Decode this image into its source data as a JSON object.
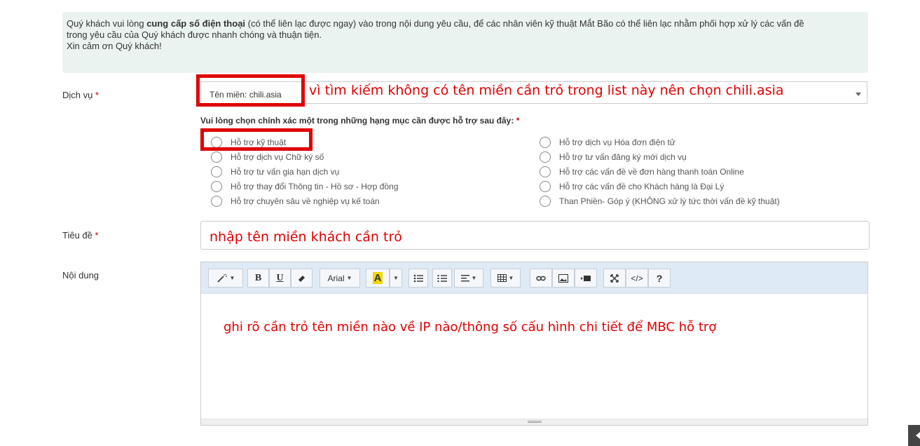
{
  "notice": {
    "line1_prefix": "Quý khách vui lòng ",
    "line1_bold": "cung cấp số điện thoại",
    "line1_suffix": " (có thể liên lạc được ngay) vào trong nội dung yêu cầu, để các nhân viên kỹ thuật Mắt Bão có thể liên lạc nhằm phối hợp xử lý các vấn đề",
    "line2": "trong yêu cầu của Quý khách được nhanh chóng và thuận tiện.",
    "line3": "Xin cảm ơn Quý khách!"
  },
  "service": {
    "label": "Dịch vụ",
    "required": "*",
    "selected_value": "Tên miền: chili.asia",
    "annotation": "vì tìm kiếm không có tên miền cần trỏ trong list này nên chọn chili.asia"
  },
  "categories": {
    "title": "Vui lòng chọn chính xác một trong những hạng mục cần được hỗ trợ sau đây:",
    "required": "*",
    "left": [
      "Hỗ trợ kỹ thuật",
      "Hỗ trợ dịch vụ Chữ ký số",
      "Hỗ trợ tư vấn gia hạn dịch vụ",
      "Hỗ trợ thay đổi Thông tin - Hồ sơ - Hợp đồng",
      "Hỗ trợ chuyên sâu về nghiệp vụ kế toán"
    ],
    "right": [
      "Hỗ trợ dịch vụ Hóa đơn điện tử",
      "Hỗ trợ tư vấn đăng ký mới dịch vụ",
      "Hỗ trợ các vấn đề về đơn hàng thanh toán Online",
      "Hỗ trợ các vấn đề cho Khách hàng là Đại Lý",
      "Than Phiền- Góp ý (KHÔNG xử lý tức thời vấn đề kỹ thuật)"
    ]
  },
  "subject": {
    "label": "Tiêu đề",
    "required": "*",
    "annotation": "nhập tên miền khách cần trỏ"
  },
  "content": {
    "label": "Nội dung",
    "annotation": "ghi rõ cần trỏ tên miền nào về IP nào/thông số cấu hình chi tiết để MBC hỗ trợ"
  },
  "toolbar": {
    "font_name": "Arial",
    "bold": "B",
    "underline": "U",
    "help": "?",
    "highlight_letter": "A",
    "highlight_color": "#f2d600"
  },
  "colors": {
    "annotation_red": "#e00000",
    "notice_bg": "#eaf3f0",
    "toolbar_bg": "#deeaf5"
  }
}
